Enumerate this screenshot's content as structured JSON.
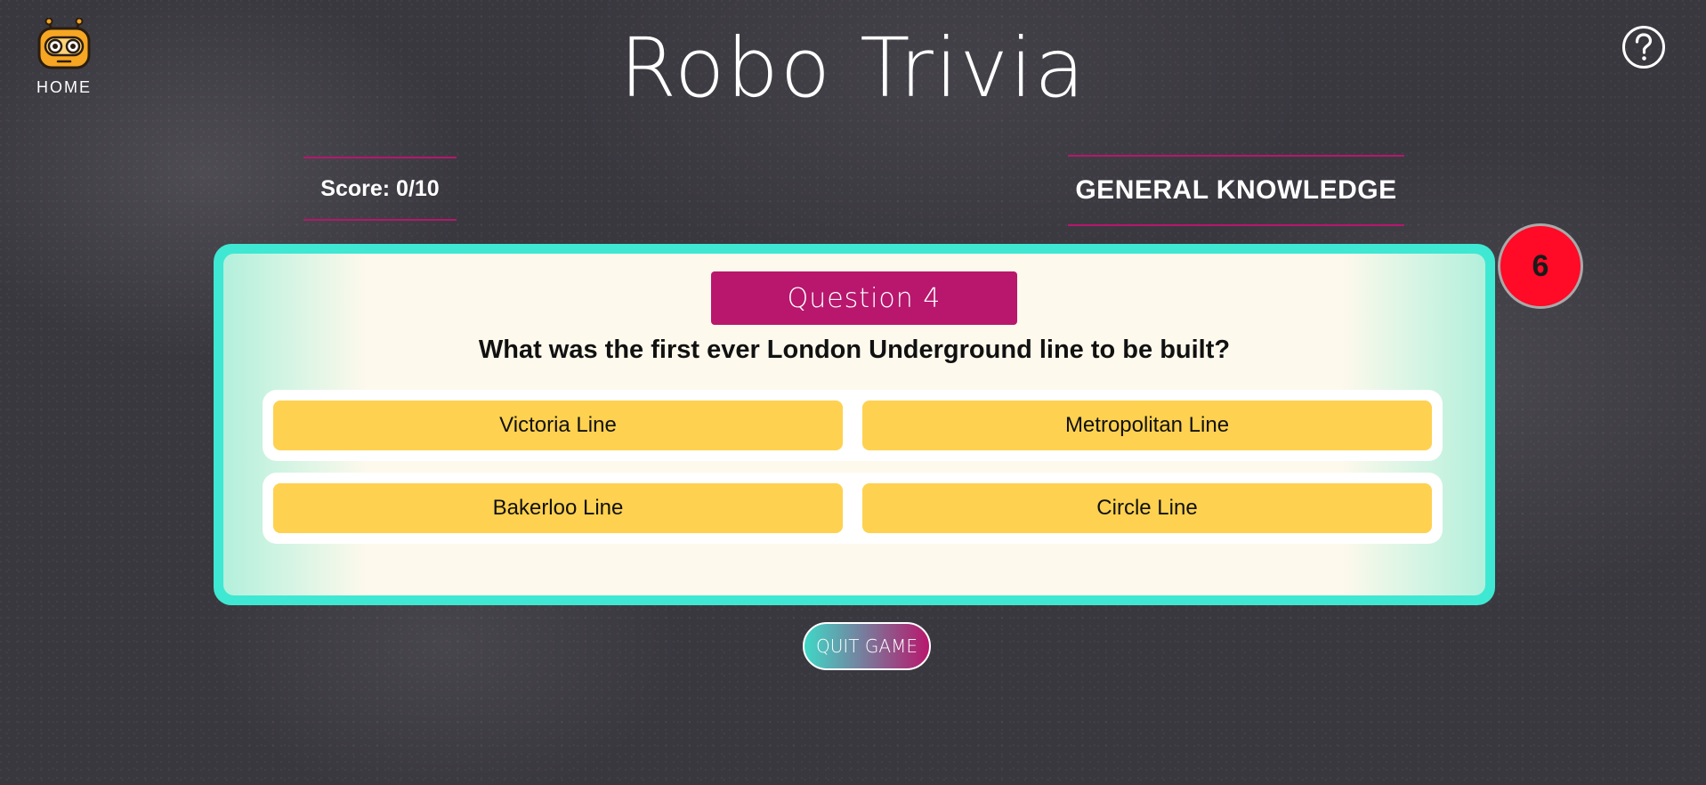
{
  "app": {
    "title": "Robo Trivia"
  },
  "nav": {
    "home_label": "HOME",
    "home_icon": "robot-logo-icon",
    "help_icon": "question-circle-icon"
  },
  "game": {
    "score_text": "Score: 0/10",
    "category": "GENERAL KNOWLEDGE",
    "question_label": "Question 4",
    "question_text": "What was the first ever London Underground line to be built?",
    "answers": [
      "Victoria Line",
      "Metropolitan Line",
      "Bakerloo Line",
      "Circle Line"
    ],
    "timer_value": "6",
    "quit_label": "QUIT GAME"
  },
  "colors": {
    "background": "#3a383f",
    "accent_magenta": "#b8176d",
    "card_border_teal": "#3fe8d2",
    "card_background": "#fdf9ec",
    "answer_yellow": "#fed150",
    "timer_red": "#ff0a27"
  }
}
